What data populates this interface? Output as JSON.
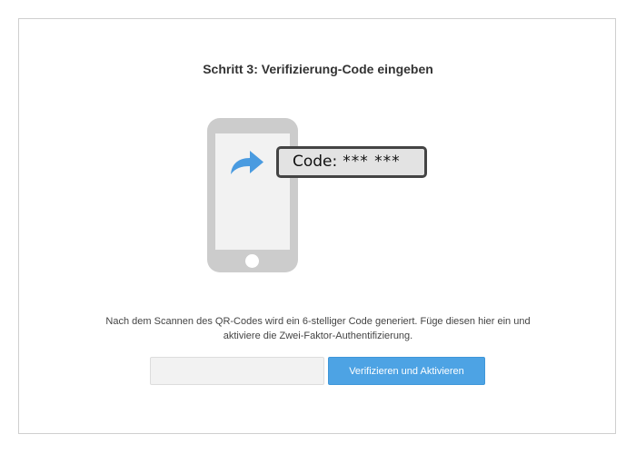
{
  "step_title": "Schritt 3: Verifizierung-Code eingeben",
  "illustration": {
    "icons": [
      "phone-icon",
      "share-arrow-icon"
    ],
    "code_label": "Code:",
    "code_mask": "*** ***"
  },
  "description": {
    "line1": "Nach dem Scannen des QR-Codes wird ein 6-stelliger Code generiert. Füge diesen hier ein und",
    "line2": "aktiviere die Zwei-Faktor-Authentifizierung."
  },
  "form": {
    "code_input_value": "",
    "code_input_placeholder": "",
    "submit_label": "Verifizieren und Aktivieren"
  },
  "colors": {
    "accent": "#4da3e4",
    "arrow": "#4a9be0",
    "phone": "#cccccc",
    "title_text": "#333333"
  }
}
